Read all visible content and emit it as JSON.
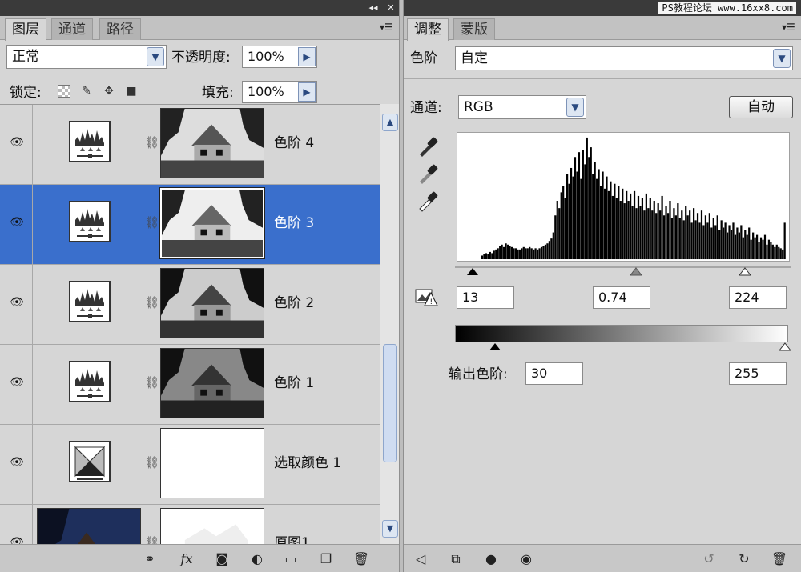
{
  "watermark": "PS教程论坛 www.16xx8.com",
  "layers_panel": {
    "tabs": [
      "图层",
      "通道",
      "路径"
    ],
    "blend_mode": "正常",
    "opacity_label": "不透明度:",
    "opacity_value": "100%",
    "lock_label": "锁定:",
    "fill_label": "填充:",
    "fill_value": "100%",
    "layers": [
      {
        "name": "色阶 4",
        "type": "levels",
        "visible": true,
        "selected": false
      },
      {
        "name": "色阶 3",
        "type": "levels",
        "visible": true,
        "selected": true
      },
      {
        "name": "色阶 2",
        "type": "levels",
        "visible": true,
        "selected": false
      },
      {
        "name": "色阶 1",
        "type": "levels",
        "visible": true,
        "selected": false
      },
      {
        "name": "选取颜色 1",
        "type": "selective-color",
        "visible": true,
        "selected": false
      },
      {
        "name": "原图1",
        "type": "image",
        "visible": true,
        "selected": false
      }
    ],
    "bottom_icons": [
      "link-icon",
      "fx-icon",
      "mask-icon",
      "adjustment-layer-icon",
      "folder-icon",
      "new-layer-icon",
      "trash-icon"
    ]
  },
  "adjust_panel": {
    "tabs": [
      "调整",
      "蒙版"
    ],
    "title": "色阶",
    "preset": "自定",
    "channel_label": "通道:",
    "channel_value": "RGB",
    "auto_label": "自动",
    "input_black": "13",
    "input_gamma": "0.74",
    "input_white": "224",
    "output_label": "输出色阶:",
    "output_black": "30",
    "output_white": "255",
    "bottom_icons": [
      "back-arrow-icon",
      "clip-to-layer-icon",
      "view-previous-icon",
      "eye-icon",
      "reset-icon",
      "refresh-icon",
      "trash-icon"
    ]
  },
  "chart_data": {
    "type": "bar",
    "title": "",
    "xlabel": "",
    "ylabel": "",
    "xlim": [
      0,
      255
    ],
    "ylim": [
      0,
      100
    ],
    "values": [
      3,
      4,
      5,
      4,
      6,
      5,
      7,
      8,
      9,
      11,
      12,
      10,
      13,
      12,
      11,
      10,
      9,
      9,
      8,
      8,
      9,
      10,
      9,
      9,
      10,
      9,
      8,
      9,
      8,
      9,
      10,
      11,
      12,
      13,
      15,
      17,
      22,
      36,
      48,
      42,
      55,
      60,
      50,
      70,
      62,
      75,
      68,
      84,
      72,
      88,
      66,
      90,
      78,
      100,
      84,
      92,
      70,
      80,
      66,
      74,
      60,
      72,
      58,
      68,
      56,
      64,
      52,
      62,
      50,
      60,
      48,
      58,
      46,
      56,
      48,
      54,
      44,
      56,
      42,
      52,
      44,
      50,
      40,
      54,
      42,
      50,
      40,
      48,
      38,
      46,
      40,
      52,
      36,
      44,
      38,
      48,
      34,
      42,
      36,
      46,
      34,
      40,
      32,
      44,
      36,
      40,
      30,
      42,
      32,
      38,
      30,
      40,
      28,
      36,
      30,
      38,
      26,
      34,
      28,
      36,
      24,
      32,
      26,
      30,
      22,
      28,
      24,
      30,
      20,
      26,
      22,
      28,
      18,
      24,
      20,
      26,
      16,
      22,
      18,
      20,
      14,
      18,
      16,
      20,
      12,
      16,
      14,
      12,
      10,
      12,
      10,
      9,
      8,
      30
    ]
  }
}
